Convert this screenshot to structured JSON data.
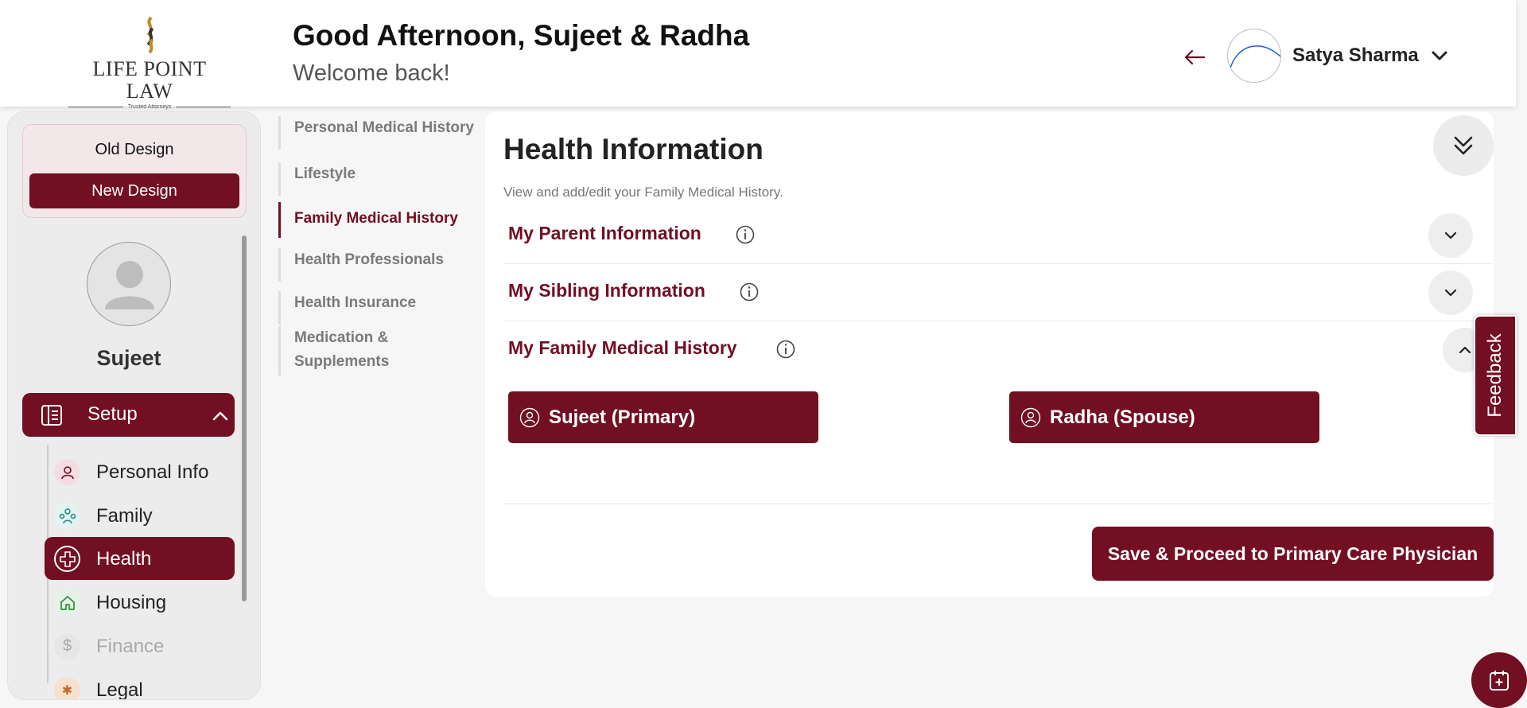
{
  "header": {
    "logo": {
      "name": "LIFE POINT LAW",
      "tagline": "Trusted Attorneys"
    },
    "greeting": "Good Afternoon, Sujeet & Radha",
    "welcome": "Welcome back!",
    "user_name": "Satya Sharma"
  },
  "sidebar": {
    "old_design": "Old Design",
    "new_design": "New Design",
    "profile_name": "Sujeet",
    "setup_label": "Setup",
    "items": [
      {
        "label": "Personal Info",
        "icon": "person-icon",
        "state": "normal"
      },
      {
        "label": "Family",
        "icon": "family-icon",
        "state": "normal"
      },
      {
        "label": "Health",
        "icon": "health-cross-icon",
        "state": "active"
      },
      {
        "label": "Housing",
        "icon": "home-icon",
        "state": "normal"
      },
      {
        "label": "Finance",
        "icon": "dollar-icon",
        "state": "disabled"
      },
      {
        "label": "Legal",
        "icon": "legal-icon",
        "state": "normal"
      }
    ]
  },
  "subnav": {
    "items": [
      {
        "label": "Personal Medical History",
        "active": false
      },
      {
        "label": "Lifestyle",
        "active": false
      },
      {
        "label": "Family Medical History",
        "active": true
      },
      {
        "label": "Health Professionals",
        "active": false
      },
      {
        "label": "Health Insurance",
        "active": false
      },
      {
        "label": "Medication & Supplements",
        "active": false
      }
    ]
  },
  "main": {
    "title": "Health Information",
    "subtitle": "View and add/edit your Family Medical History.",
    "sections": [
      {
        "title": "My Parent Information",
        "expanded": false
      },
      {
        "title": "My Sibling Information",
        "expanded": false
      },
      {
        "title": "My Family Medical History",
        "expanded": true
      }
    ],
    "members": [
      "Sujeet (Primary)",
      "Radha (Spouse)"
    ],
    "save_button": "Save & Proceed to Primary Care Physician"
  },
  "feedback_label": "Feedback",
  "colors": {
    "brand": "#720f22",
    "background": "#f6f6f6",
    "card": "#ffffff"
  }
}
